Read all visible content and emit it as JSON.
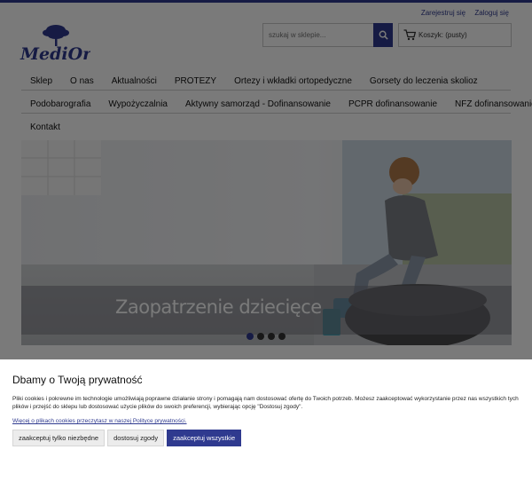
{
  "header": {
    "account_links": [
      "Zarejestruj się",
      "Zaloguj się"
    ],
    "logo_text": "MediOrth",
    "search": {
      "placeholder": "szukaj w sklepie..."
    },
    "cart": {
      "label": "Koszyk: (pusty)"
    }
  },
  "nav": {
    "row1": [
      "Sklep",
      "O nas",
      "Aktualności",
      "PROTEZY",
      "Ortezy i wkładki ortopedyczne",
      "Gorsety do leczenia skolioz"
    ],
    "row2": [
      "Podobarografia",
      "Wypożyczalnia",
      "Aktywny samorząd - Dofinansowanie",
      "PCPR dofinansowanie",
      "NFZ dofinansowanie"
    ],
    "row3": [
      "Kontakt"
    ]
  },
  "banner": {
    "caption": "Zaopatrzenie dziecięce",
    "slides": 4,
    "active_slide": 1
  },
  "cookie": {
    "title": "Dbamy o Twoją prywatność",
    "text": "Pliki cookies i pokrewne im technologie umożliwiają poprawne działanie strony i pomagają nam dostosować ofertę do Twoich potrzeb. Możesz zaakceptować wykorzystanie przez nas wszystkich tych plików i przejść do sklepu lub dostosować użycie plików do swoich preferencji, wybierając opcję \"Dostosuj zgody\".",
    "link": "Więcej o plikach cookies przeczytasz w naszej Polityce prywatności.",
    "buttons": [
      "zaakceptuj tylko niezbędne",
      "dostosuj zgody",
      "zaakceptuj wszystkie"
    ]
  },
  "colors": {
    "brand": "#2f3a8f",
    "overlay": "rgba(0,0,0,0.52)"
  }
}
